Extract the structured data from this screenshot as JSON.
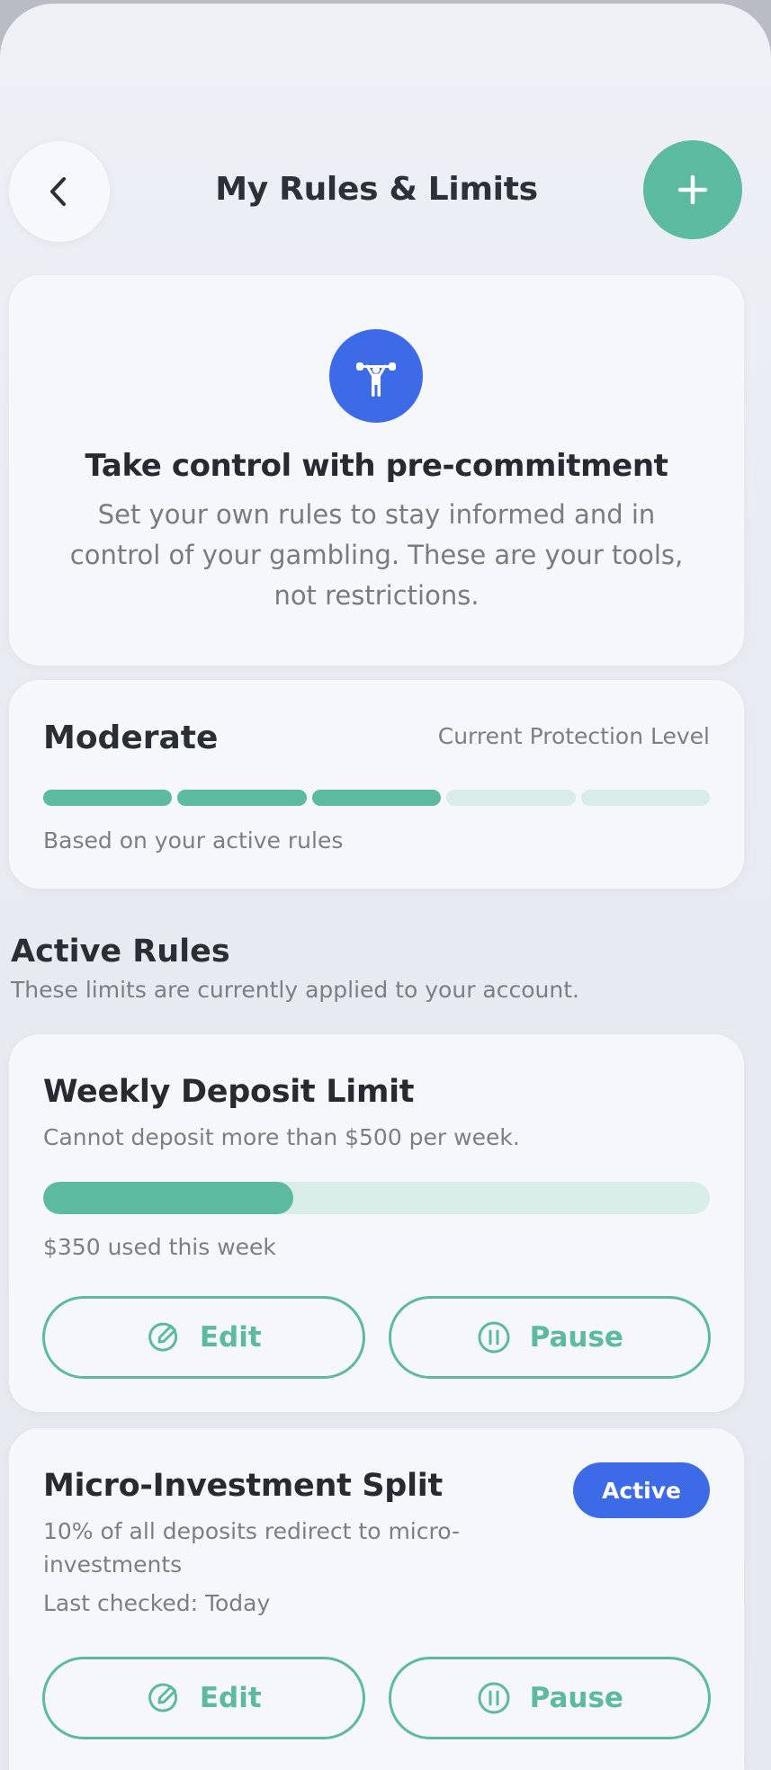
{
  "header": {
    "title": "My Rules & Limits",
    "back_icon": "chevron-left-icon",
    "add_icon": "plus-icon"
  },
  "hero": {
    "icon": "weightlifter-icon",
    "title": "Take control with pre-commitment",
    "description": "Set your own rules to stay informed and in control of your gambling. These are your tools, not restrictions."
  },
  "protection": {
    "level": "Moderate",
    "label": "Current Protection Level",
    "segments_total": 5,
    "segments_active": 3,
    "note": "Based on your active rules"
  },
  "active_rules": {
    "title": "Active Rules",
    "subtitle": "These limits are currently applied to your account.",
    "rules": [
      {
        "title": "Weekly Deposit Limit",
        "description": "Cannot deposit more than $500 per week.",
        "progress_fraction": 0.375,
        "caption": "$350 used this week",
        "edit_label": "Edit",
        "pause_label": "Pause"
      },
      {
        "title": "Micro-Investment Split",
        "description": "10% of all deposits redirect to micro-investments",
        "status": "Active",
        "meta": "Last checked: Today",
        "edit_label": "Edit",
        "pause_label": "Pause"
      }
    ]
  },
  "colors": {
    "accent": "#5bbaa0",
    "accent_light": "#d8ede7",
    "primary_blue": "#3d6be8",
    "card": "#f6f7fa"
  }
}
